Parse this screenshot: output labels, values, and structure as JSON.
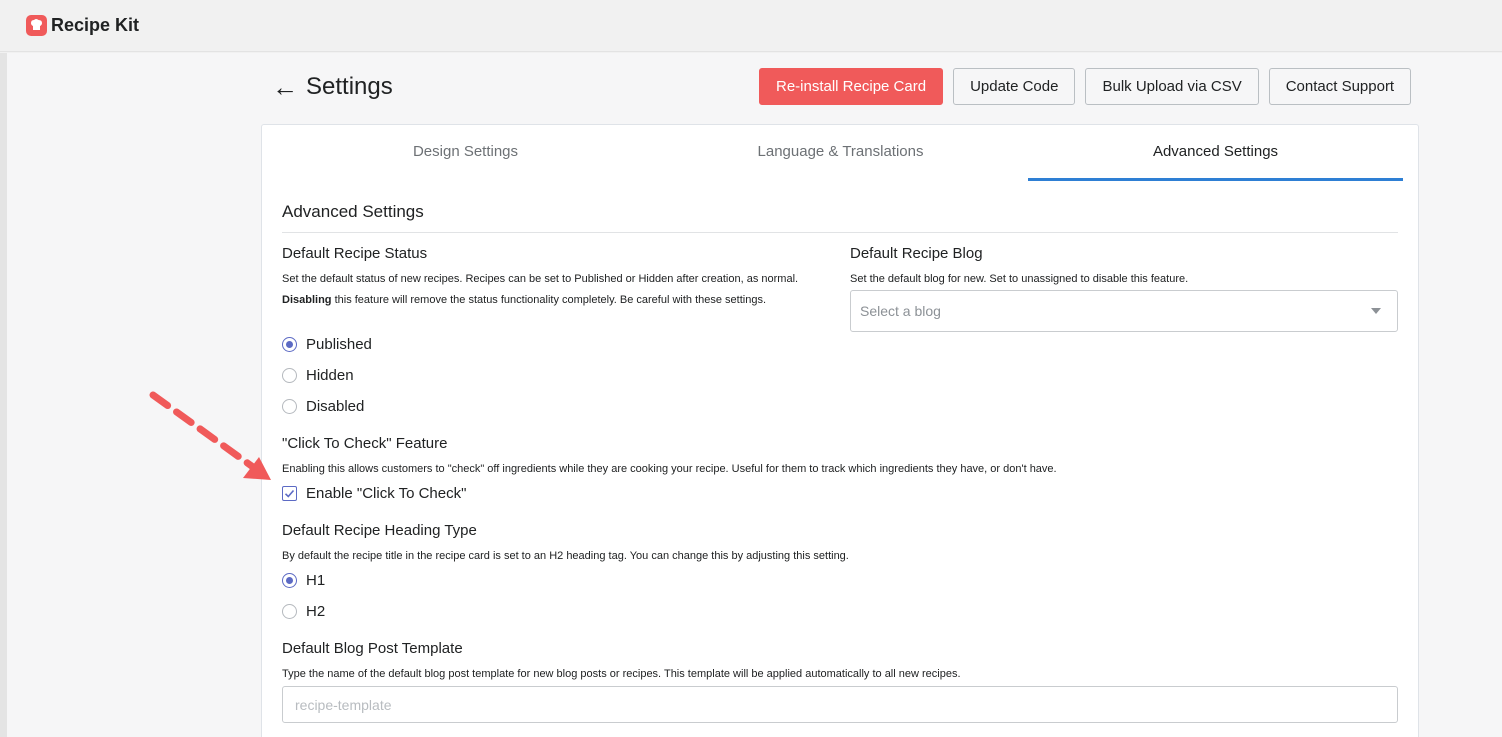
{
  "app": {
    "title": "Recipe Kit",
    "logo_icon": "recipe-kit-logo-icon",
    "brand_color": "#f05a5a"
  },
  "page": {
    "title": "Settings",
    "back_icon": "arrow-left-icon",
    "back_glyph": "←"
  },
  "actions": {
    "reinstall": "Re-install Recipe Card",
    "update_code": "Update Code",
    "bulk_upload": "Bulk Upload via CSV",
    "contact_support": "Contact Support"
  },
  "tabs": [
    {
      "label": "Design Settings",
      "active": false
    },
    {
      "label": "Language & Translations",
      "active": false
    },
    {
      "label": "Advanced Settings",
      "active": true
    }
  ],
  "section_title": "Advanced Settings",
  "recipe_status": {
    "label": "Default Recipe Status",
    "help_pre": "Set the default status of new recipes. Recipes can be set to Published or Hidden after creation, as normal. ",
    "help_bold": "Disabling",
    "help_post": " this feature will remove the status functionality completely. Be careful with these settings.",
    "options": [
      "Published",
      "Hidden",
      "Disabled"
    ],
    "selected": "Published"
  },
  "recipe_blog": {
    "label": "Default Recipe Blog",
    "help": "Set the default blog for new. Set to unassigned to disable this feature.",
    "placeholder": "Select a blog"
  },
  "click_to_check": {
    "label": "\"Click To Check\" Feature",
    "help": "Enabling this allows customers to \"check\" off ingredients while they are cooking your recipe. Useful for them to track which ingredients they have, or don't have.",
    "checkbox_label": "Enable \"Click To Check\"",
    "checked": true
  },
  "heading_type": {
    "label": "Default Recipe Heading Type",
    "help": "By default the recipe title in the recipe card is set to an H2 heading tag. You can change this by adjusting this setting.",
    "options": [
      "H1",
      "H2"
    ],
    "selected": "H1"
  },
  "post_template": {
    "label": "Default Blog Post Template",
    "help": "Type the name of the default blog post template for new blog posts or recipes. This template will be applied automatically to all new recipes.",
    "placeholder": "recipe-template",
    "value": ""
  },
  "colors": {
    "accent": "#5c6ac4",
    "tab_underline": "#2e7fd4",
    "annotation_arrow": "#f05a5a"
  }
}
